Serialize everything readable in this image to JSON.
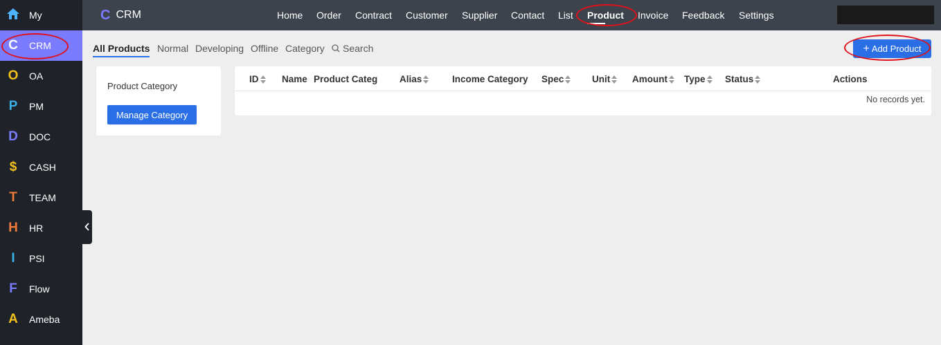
{
  "sidebar": {
    "items": [
      {
        "icon": "home-icon",
        "letter": "",
        "label": "My",
        "color": "#4db3ff"
      },
      {
        "icon": "crm-icon",
        "letter": "C",
        "label": "CRM",
        "color": "#ffffff",
        "active": true
      },
      {
        "icon": "oa-icon",
        "letter": "O",
        "label": "OA",
        "color": "#f2c21b"
      },
      {
        "icon": "pm-icon",
        "letter": "P",
        "label": "PM",
        "color": "#3ab0e6"
      },
      {
        "icon": "doc-icon",
        "letter": "D",
        "label": "DOC",
        "color": "#7b7bff"
      },
      {
        "icon": "cash-icon",
        "letter": "$",
        "label": "CASH",
        "color": "#f2c21b"
      },
      {
        "icon": "team-icon",
        "letter": "T",
        "label": "TEAM",
        "color": "#f07a3a"
      },
      {
        "icon": "hr-icon",
        "letter": "H",
        "label": "HR",
        "color": "#f07a3a"
      },
      {
        "icon": "psi-icon",
        "letter": "I",
        "label": "PSI",
        "color": "#3ab0e6"
      },
      {
        "icon": "flow-icon",
        "letter": "F",
        "label": "Flow",
        "color": "#7b7bff"
      },
      {
        "icon": "ameba-icon",
        "letter": "A",
        "label": "Ameba",
        "color": "#f2c21b"
      }
    ]
  },
  "topbar": {
    "brand_letter": "C",
    "brand": "CRM",
    "nav": [
      {
        "label": "Home"
      },
      {
        "label": "Order"
      },
      {
        "label": "Contract"
      },
      {
        "label": "Customer"
      },
      {
        "label": "Supplier"
      },
      {
        "label": "Contact"
      },
      {
        "label": "List"
      },
      {
        "label": "Product",
        "active": true
      },
      {
        "label": "Invoice"
      },
      {
        "label": "Feedback"
      },
      {
        "label": "Settings"
      }
    ]
  },
  "subtabs": {
    "items": [
      "All Products",
      "Normal",
      "Developing",
      "Offline",
      "Category"
    ],
    "search": "Search",
    "add_button": "Add Product"
  },
  "category_panel": {
    "title": "Product Category",
    "manage_button": "Manage Category"
  },
  "table": {
    "columns": [
      {
        "label": "ID",
        "sortable": true
      },
      {
        "label": "Name",
        "sortable": false
      },
      {
        "label": "Product Categ",
        "sortable": false
      },
      {
        "label": "Alias",
        "sortable": true
      },
      {
        "label": "Income Category",
        "sortable": false
      },
      {
        "label": "Spec",
        "sortable": true
      },
      {
        "label": "Unit",
        "sortable": true
      },
      {
        "label": "Amount",
        "sortable": true
      },
      {
        "label": "Type",
        "sortable": true
      },
      {
        "label": "Status",
        "sortable": true
      },
      {
        "label": "Actions",
        "sortable": false
      }
    ],
    "empty_text": "No records yet."
  },
  "colors": {
    "accent": "#2b6fe6",
    "sidebar_active": "#7b7bff",
    "highlight_ring": "#e0101b"
  }
}
